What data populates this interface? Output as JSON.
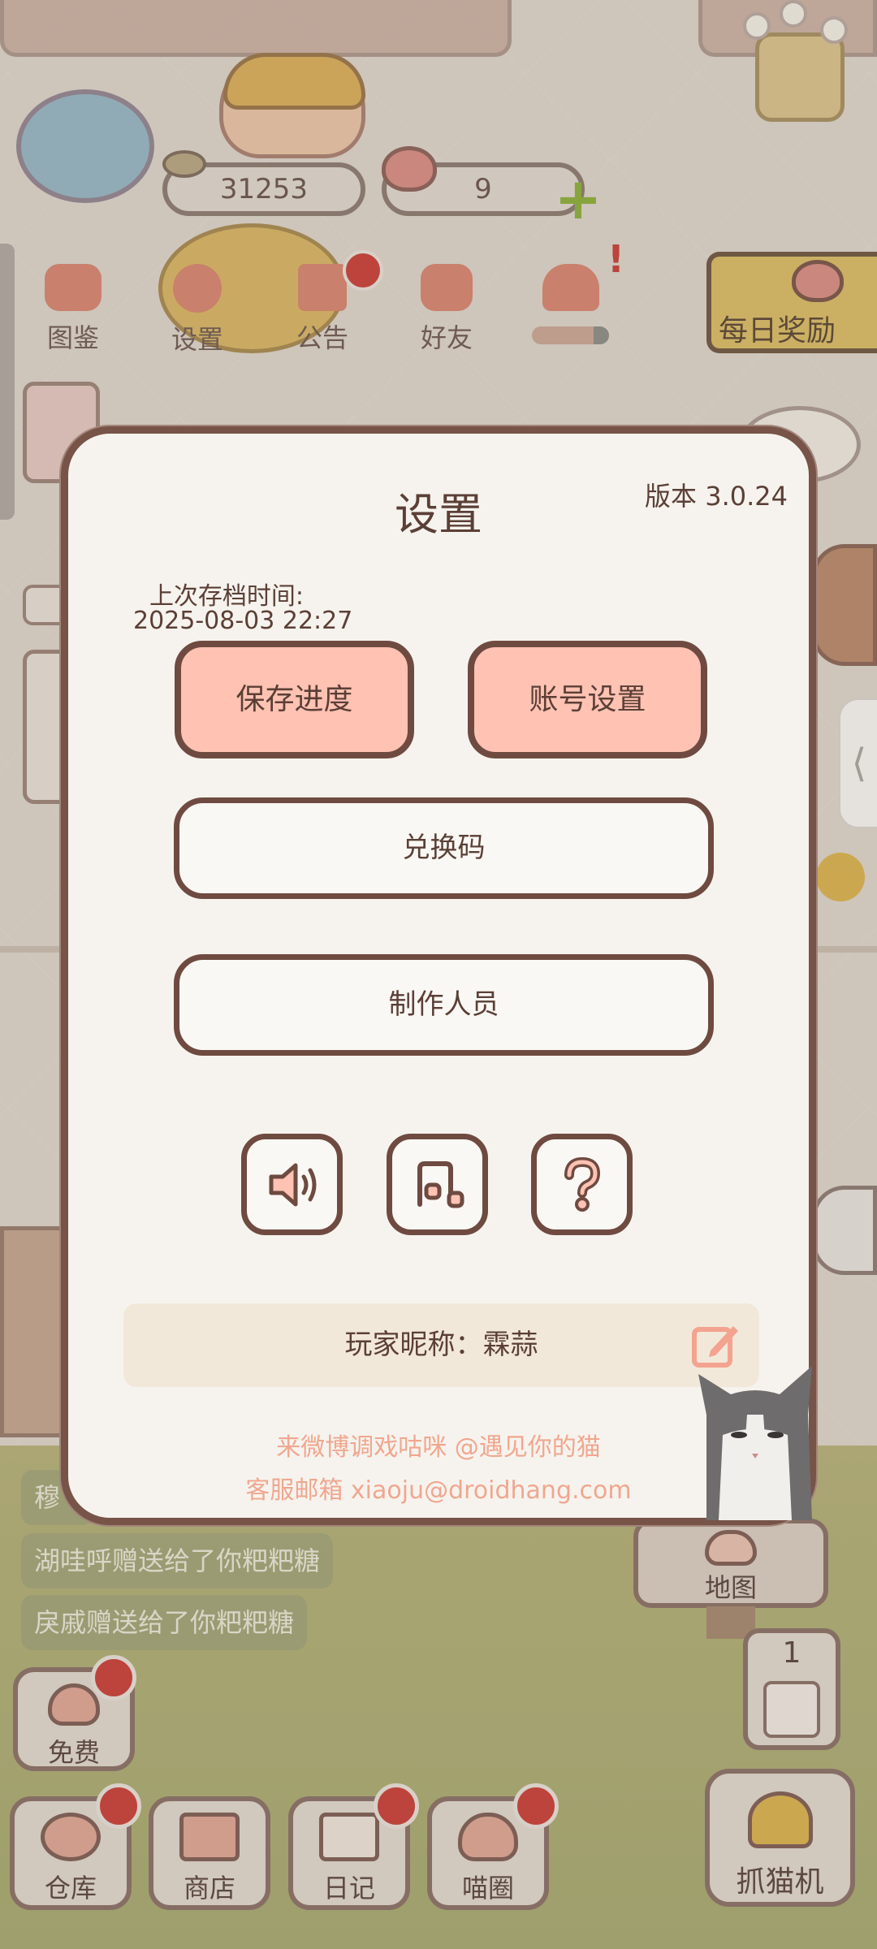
{
  "hud": {
    "coins": "31253",
    "hearts": "9",
    "menu": [
      {
        "label": "图鉴"
      },
      {
        "label": "设置"
      },
      {
        "label": "公告"
      },
      {
        "label": "好友"
      }
    ],
    "daily_reward": "每日奖励"
  },
  "chat": [
    "穆",
    "湖哇呼赠送给了你粑粑糖",
    "戾戚赠送给了你粑粑糖"
  ],
  "bottom_bar": {
    "free": "免费",
    "warehouse": "仓库",
    "shop": "商店",
    "diary": "日记",
    "meow_circle": "喵圈",
    "map": "地图",
    "claw_count": "1",
    "claw_machine": "抓猫机"
  },
  "settings": {
    "title": "设置",
    "version": "版本 3.0.24",
    "last_save_label": "上次存档时间:",
    "last_save_time": "2025-08-03 22:27",
    "save_progress": "保存进度",
    "account_settings": "账号设置",
    "redeem_code": "兑换码",
    "credits": "制作人员",
    "nickname_line": "玩家昵称：霖蒜",
    "weibo_line": "来微博调戏咕咪 @遇见你的猫",
    "email_line": "客服邮箱 xiaoju@droidhang.com"
  },
  "icons": {
    "sound": "speaker-icon",
    "music": "music-note-icon",
    "help": "question-icon",
    "edit": "edit-icon"
  },
  "colors": {
    "pink_button": "#ffc2b3",
    "dialog_border": "#775348",
    "footer_text": "#f0a78f",
    "notification_dot": "#c84038"
  }
}
